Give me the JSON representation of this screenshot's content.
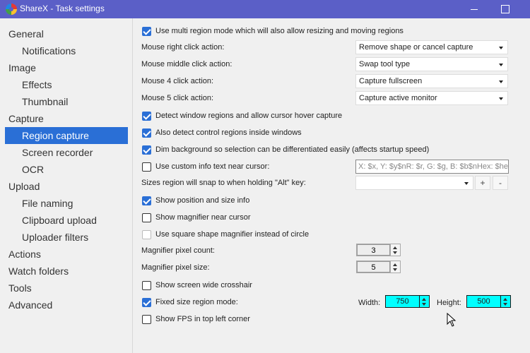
{
  "window": {
    "title": "ShareX - Task settings"
  },
  "sidebar": {
    "items": [
      {
        "label": "General"
      },
      {
        "label": "Notifications"
      },
      {
        "label": "Image"
      },
      {
        "label": "Effects"
      },
      {
        "label": "Thumbnail"
      },
      {
        "label": "Capture"
      },
      {
        "label": "Region capture"
      },
      {
        "label": "Screen recorder"
      },
      {
        "label": "OCR"
      },
      {
        "label": "Upload"
      },
      {
        "label": "File naming"
      },
      {
        "label": "Clipboard upload"
      },
      {
        "label": "Uploader filters"
      },
      {
        "label": "Actions"
      },
      {
        "label": "Watch folders"
      },
      {
        "label": "Tools"
      },
      {
        "label": "Advanced"
      }
    ],
    "selected": "Region capture"
  },
  "settings": {
    "multi_region": {
      "label": "Use multi region mode which will also allow resizing and moving regions",
      "checked": true
    },
    "mouse_right": {
      "label": "Mouse right click action:",
      "value": "Remove shape or cancel capture"
    },
    "mouse_middle": {
      "label": "Mouse middle click action:",
      "value": "Swap tool type"
    },
    "mouse4": {
      "label": "Mouse 4 click action:",
      "value": "Capture fullscreen"
    },
    "mouse5": {
      "label": "Mouse 5 click action:",
      "value": "Capture active monitor"
    },
    "detect_windows": {
      "label": "Detect window regions and allow cursor hover capture",
      "checked": true
    },
    "detect_controls": {
      "label": "Also detect control regions inside windows",
      "checked": true
    },
    "dim_background": {
      "label": "Dim background so selection can be differentiated easily (affects startup speed)",
      "checked": true
    },
    "custom_info": {
      "label": "Use custom info text near cursor:",
      "checked": false,
      "placeholder": "X: $x, Y: $y$nR: $r, G: $g, B: $b$nHex: $hex"
    },
    "snap_sizes": {
      "label": "Sizes region will snap to when holding \"Alt\" key:",
      "value": "",
      "add": "+",
      "remove": "-"
    },
    "show_position": {
      "label": "Show position and size info",
      "checked": true
    },
    "show_magnifier": {
      "label": "Show magnifier near cursor",
      "checked": false
    },
    "square_magnifier": {
      "label": "Use square shape magnifier instead of circle",
      "checked": false
    },
    "magnifier_count": {
      "label": "Magnifier pixel count:",
      "value": "3"
    },
    "magnifier_size": {
      "label": "Magnifier pixel size:",
      "value": "5"
    },
    "crosshair": {
      "label": "Show screen wide crosshair",
      "checked": false
    },
    "fixed_size": {
      "label": "Fixed size region mode:",
      "checked": true,
      "width_label": "Width:",
      "width": "750",
      "height_label": "Height:",
      "height": "500"
    },
    "show_fps": {
      "label": "Show FPS in top left corner",
      "checked": false
    }
  },
  "colors": {
    "accent": "#2a6fd6",
    "titlebar": "#5b5fc7",
    "highlight_input": "#00ffff"
  }
}
